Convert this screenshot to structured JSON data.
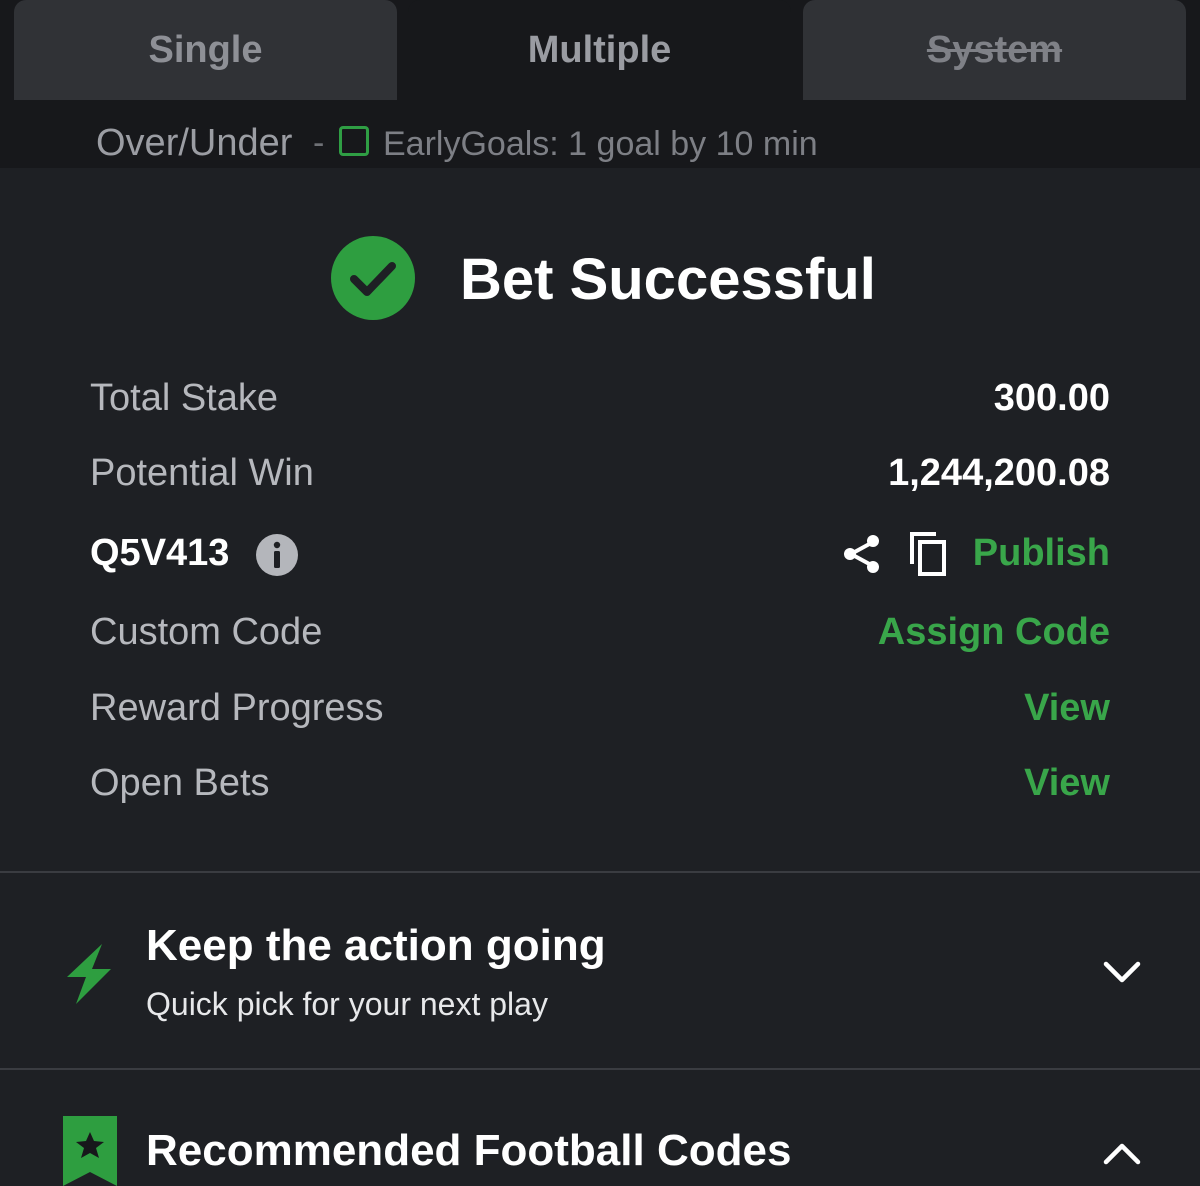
{
  "tabs": {
    "single": "Single",
    "multiple": "Multiple",
    "system": "System"
  },
  "selection": {
    "market": "Over/Under",
    "separator": "-",
    "outcome": "EarlyGoals: 1 goal by 10 min"
  },
  "success": {
    "title": "Bet Successful",
    "icon": "check-circle-icon"
  },
  "details": {
    "total_stake_label": "Total Stake",
    "total_stake_value": "300.00",
    "potential_win_label": "Potential Win",
    "potential_win_value": "1,244,200.08",
    "booking_code": "Q5V413",
    "publish_label": "Publish",
    "custom_code_label": "Custom Code",
    "custom_code_action": "Assign Code",
    "reward_progress_label": "Reward Progress",
    "reward_progress_action": "View",
    "open_bets_label": "Open Bets",
    "open_bets_action": "View"
  },
  "promo_keep": {
    "title": "Keep the action going",
    "subtitle": "Quick pick for your next play",
    "icon": "lightning-bolt-icon"
  },
  "promo_codes": {
    "title": "Recommended Football Codes",
    "icon": "star-bookmark-icon"
  },
  "colors": {
    "accent_green": "#39a64a",
    "background": "#1e2024",
    "tab_bg": "#303236"
  }
}
